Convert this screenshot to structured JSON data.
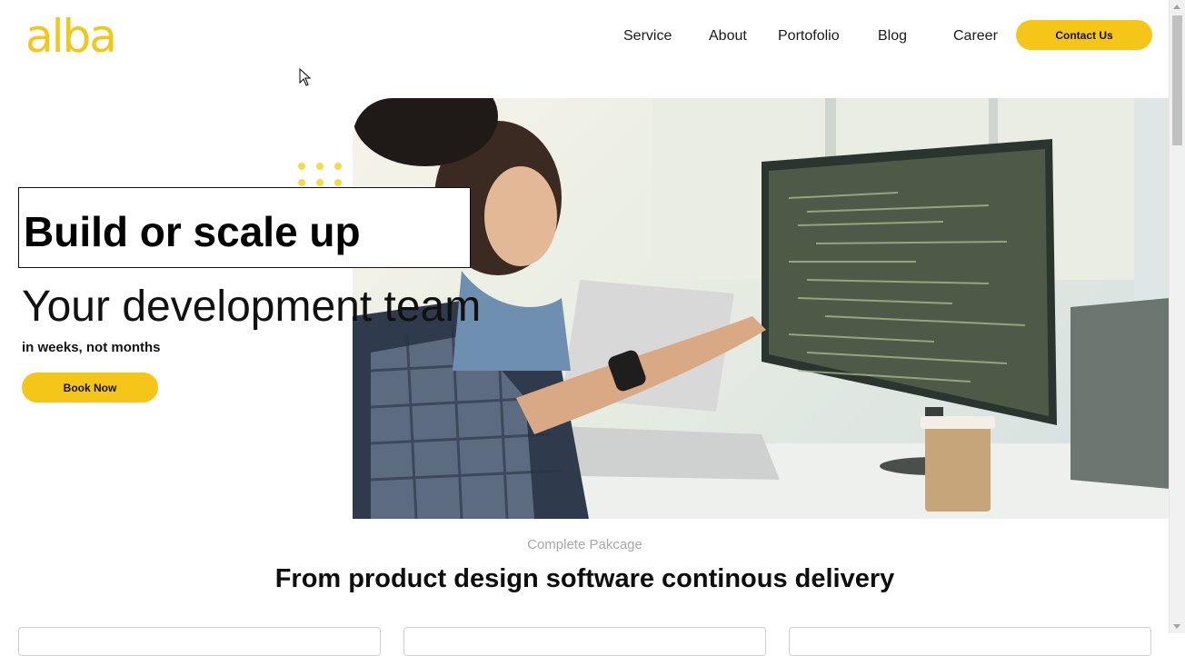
{
  "brand": {
    "logo_text": "alba",
    "accent_color": "#f5c518"
  },
  "nav": {
    "links": [
      {
        "label": "Service"
      },
      {
        "label": "About"
      },
      {
        "label": "Portofolio"
      },
      {
        "label": "Blog"
      },
      {
        "label": "Career"
      }
    ],
    "cta_label": "Contact Us"
  },
  "hero": {
    "title": "Build or scale up",
    "subtitle": "Your development team",
    "tagline": "in weeks, not months",
    "cta_label": "Book Now",
    "image_icon": "team-coding-photo"
  },
  "section": {
    "eyebrow": "Complete Pakcage",
    "title": "From product design software continous delivery"
  }
}
